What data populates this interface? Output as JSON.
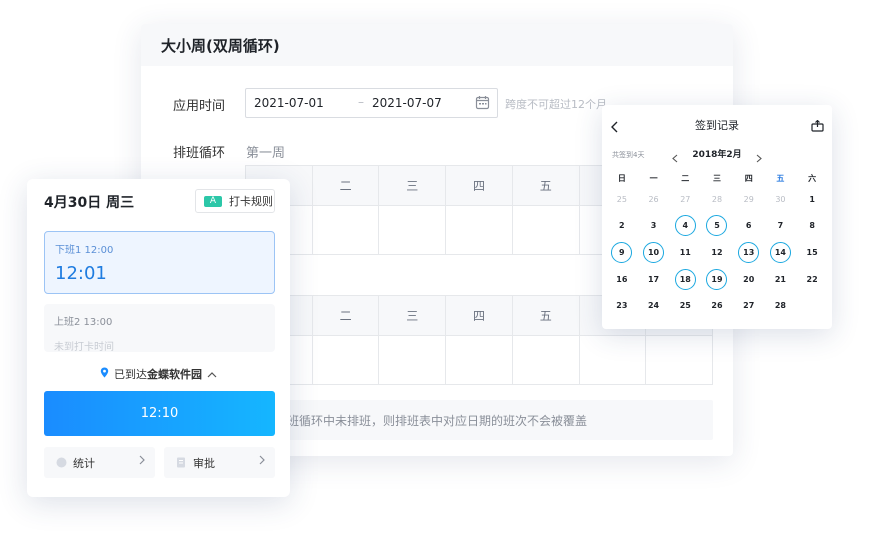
{
  "main": {
    "title": "大小周(双周循环)",
    "apply_time_label": "应用时间",
    "start_date": "2021-07-01",
    "date_separator": "–",
    "end_date": "2021-07-07",
    "hint": "跨度不可超过12个月",
    "cycle_label": "排班循环",
    "week_label": "第一周",
    "weekdays": [
      "",
      "二",
      "三",
      "四",
      "五",
      "",
      ""
    ],
    "note": "班循环中未排班，则排班表中对应日期的班次不会被覆盖"
  },
  "phone": {
    "date": "4月30日 周三",
    "rule_badge": "A",
    "rule_label": "打卡规则",
    "shift1": {
      "title": "下班1  12:00",
      "time": "12:01"
    },
    "shift2": {
      "title": "上班2  13:00",
      "sub": "未到打卡时间"
    },
    "location_prefix": "已到达",
    "location_name": "金蝶软件园",
    "clock_time": "12:10",
    "stats_label": "统计",
    "approve_label": "审批"
  },
  "calendar": {
    "title": "签到记录",
    "total": "共签到4天",
    "month": "2018年2月",
    "weekdays": [
      "日",
      "一",
      "二",
      "三",
      "四",
      "五",
      "六"
    ],
    "days": [
      {
        "d": "25",
        "muted": true
      },
      {
        "d": "26",
        "muted": true
      },
      {
        "d": "27",
        "muted": true
      },
      {
        "d": "28",
        "muted": true
      },
      {
        "d": "29",
        "muted": true
      },
      {
        "d": "30",
        "muted": true
      },
      {
        "d": "1"
      },
      {
        "d": "2"
      },
      {
        "d": "3"
      },
      {
        "d": "4",
        "marked": true
      },
      {
        "d": "5",
        "marked": true
      },
      {
        "d": "6"
      },
      {
        "d": "7"
      },
      {
        "d": "8"
      },
      {
        "d": "9",
        "marked": true
      },
      {
        "d": "10",
        "marked": true
      },
      {
        "d": "11"
      },
      {
        "d": "12"
      },
      {
        "d": "13",
        "marked": true
      },
      {
        "d": "14",
        "marked": true
      },
      {
        "d": "15"
      },
      {
        "d": "16"
      },
      {
        "d": "17"
      },
      {
        "d": "18",
        "marked": true
      },
      {
        "d": "19",
        "marked": true
      },
      {
        "d": "20"
      },
      {
        "d": "21"
      },
      {
        "d": "22"
      },
      {
        "d": "23"
      },
      {
        "d": "24"
      },
      {
        "d": "25"
      },
      {
        "d": "26"
      },
      {
        "d": "27"
      },
      {
        "d": "28"
      },
      {
        "d": ""
      }
    ]
  },
  "colors": {
    "accent": "#1a8cff",
    "marked_ring": "#1ba8e0",
    "badge": "#2cc7a8"
  }
}
